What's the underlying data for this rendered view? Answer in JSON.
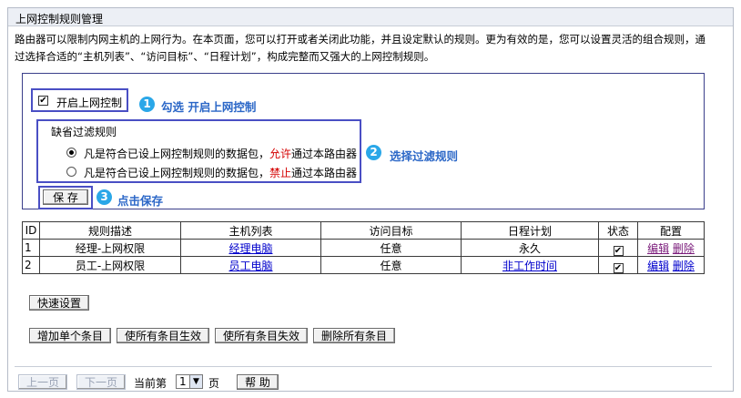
{
  "title": "上网控制规则管理",
  "description": "路由器可以限制内网主机的上网行为。在本页面，您可以打开或者关闭此功能，并且设定默认的规则。更为有效的是，您可以设置灵活的组合规则，通过选择合适的“主机列表”、“访问目标”、“日程计划”，构成完整而又强大的上网控制规则。",
  "enable": {
    "label": "开启上网控制",
    "checked": true
  },
  "callouts": [
    {
      "num": "1",
      "text": "勾选 开启上网控制"
    },
    {
      "num": "2",
      "text": "选择过滤规则"
    },
    {
      "num": "3",
      "text": "点击保存"
    }
  ],
  "filter": {
    "legend": "缺省过滤规则",
    "options": [
      {
        "prefix": "凡是符合已设上网控制规则的数据包，",
        "keyword": "允许",
        "suffix": "通过本路由器",
        "selected": true
      },
      {
        "prefix": "凡是符合已设上网控制规则的数据包，",
        "keyword": "禁止",
        "suffix": "通过本路由器",
        "selected": false
      }
    ]
  },
  "save_label": "保 存",
  "table": {
    "headers": [
      "ID",
      "规则描述",
      "主机列表",
      "访问目标",
      "日程计划",
      "状态",
      "配置"
    ],
    "rows": [
      {
        "id": "1",
        "desc": "经理-上网权限",
        "host": "经理电脑",
        "target": "任意",
        "schedule": "永久",
        "status": true,
        "edit": "编辑",
        "del": "删除"
      },
      {
        "id": "2",
        "desc": "员工-上网权限",
        "host": "员工电脑",
        "target": "任意",
        "schedule": "非工作时间",
        "status": true,
        "edit": "编辑",
        "del": "删除"
      }
    ]
  },
  "quick_setup": "快速设置",
  "actions": [
    "增加单个条目",
    "使所有条目生效",
    "使所有条目失效",
    "删除所有条目"
  ],
  "pager": {
    "prev": "上一页",
    "next": "下一页",
    "current_label": "当前第",
    "page": "1",
    "page_suffix": "页",
    "help": "帮 助"
  },
  "colors": {
    "accent": "#4a4fc4",
    "callout": "#2aa7e8",
    "callout_text": "#2b67c7",
    "keyword": "#d40000"
  }
}
